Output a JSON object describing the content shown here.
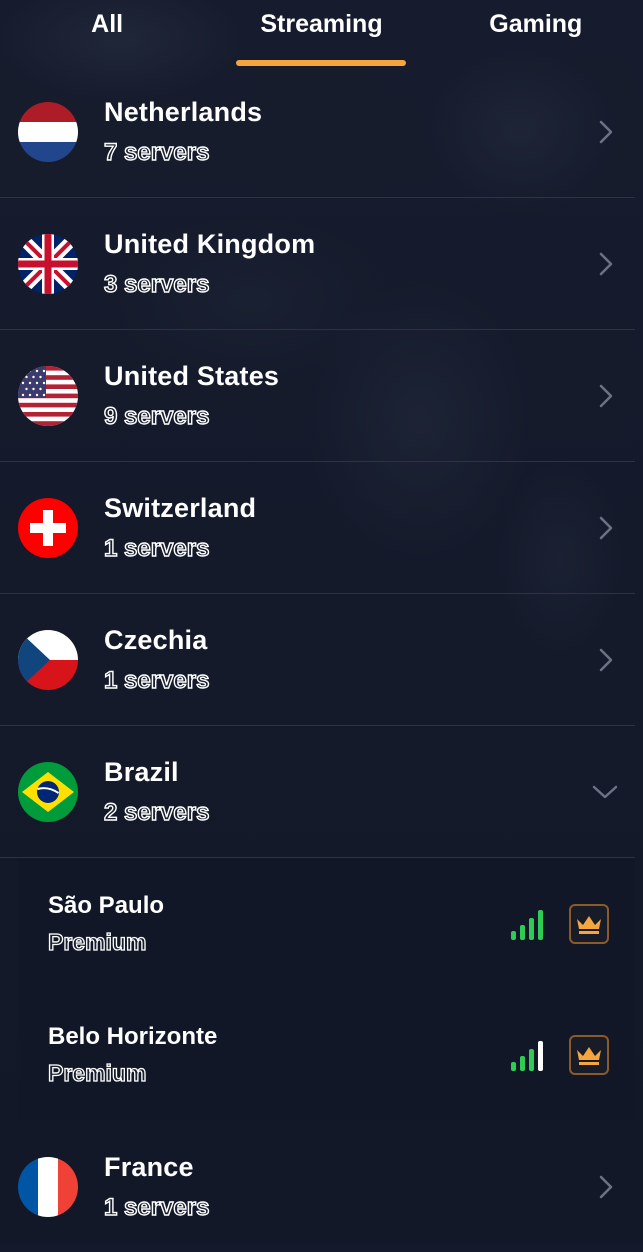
{
  "tabs": [
    {
      "label": "All",
      "active": false
    },
    {
      "label": "Streaming",
      "active": true
    },
    {
      "label": "Gaming",
      "active": false
    }
  ],
  "colors": {
    "accent": "#f4a53e",
    "signal_green": "#2ecc55",
    "signal_white": "#ffffff",
    "premium_gold": "#f4a53e"
  },
  "countries": [
    {
      "name": "Netherlands",
      "servers": "7 servers",
      "flag": "netherlands-flag-icon",
      "expanded": false
    },
    {
      "name": "United Kingdom",
      "servers": "3 servers",
      "flag": "uk-flag-icon",
      "expanded": false
    },
    {
      "name": "United States",
      "servers": "9 servers",
      "flag": "us-flag-icon",
      "expanded": false
    },
    {
      "name": "Switzerland",
      "servers": "1 servers",
      "flag": "switzerland-flag-icon",
      "expanded": false
    },
    {
      "name": "Czechia",
      "servers": "1 servers",
      "flag": "czechia-flag-icon",
      "expanded": false
    },
    {
      "name": "Brazil",
      "servers": "2 servers",
      "flag": "brazil-flag-icon",
      "expanded": true
    },
    {
      "name": "France",
      "servers": "1 servers",
      "flag": "france-flag-icon",
      "expanded": false
    }
  ],
  "brazil_cities": [
    {
      "name": "São Paulo",
      "tier": "Premium",
      "signal_bars_green": 4,
      "signal_bars_total": 4,
      "badge": "crown-icon"
    },
    {
      "name": "Belo Horizonte",
      "tier": "Premium",
      "signal_bars_green": 3,
      "signal_bars_total": 4,
      "badge": "crown-icon"
    }
  ]
}
